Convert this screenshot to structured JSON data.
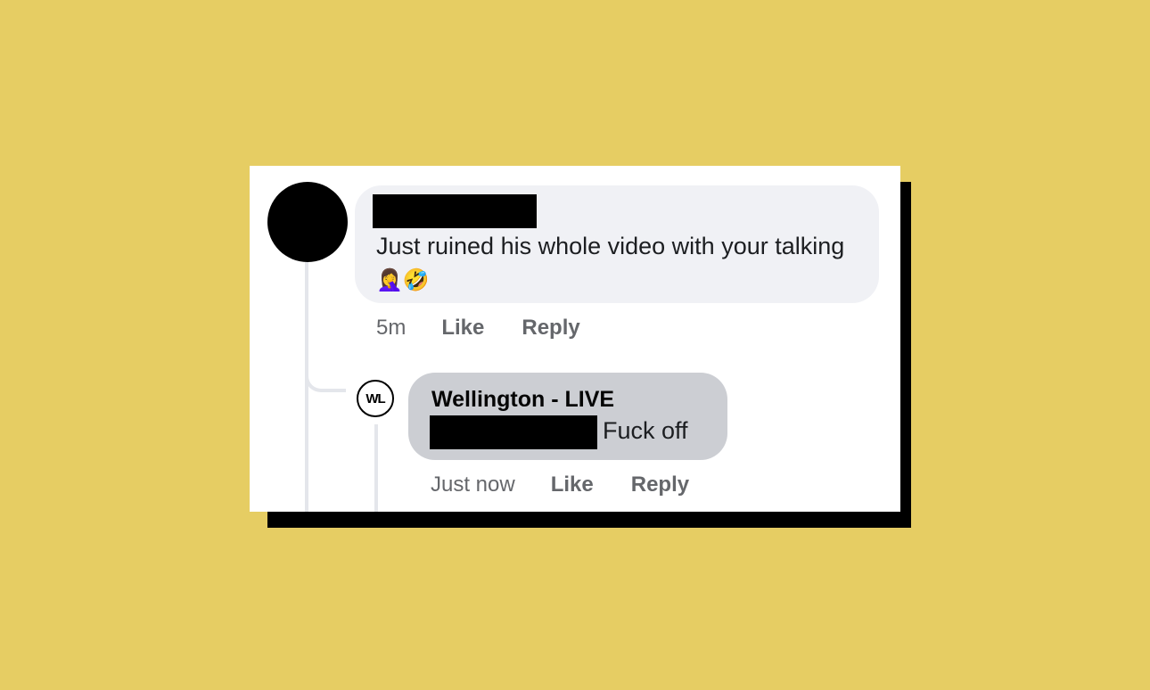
{
  "colors": {
    "background": "#e6cd63",
    "card": "#ffffff",
    "shadow": "#000000",
    "bubble_main": "#f0f1f5",
    "bubble_reply": "#ccced3",
    "action_text": "#65676b"
  },
  "comment": {
    "author": "",
    "text": "Just ruined his whole video with your talking",
    "emojis": "🤦‍♀️🤣",
    "time": "5m",
    "like_label": "Like",
    "reply_label": "Reply"
  },
  "reply": {
    "avatar_initials": "WL",
    "author": "Wellington - LIVE",
    "text": "Fuck off",
    "time": "Just now",
    "like_label": "Like",
    "reply_label": "Reply"
  }
}
